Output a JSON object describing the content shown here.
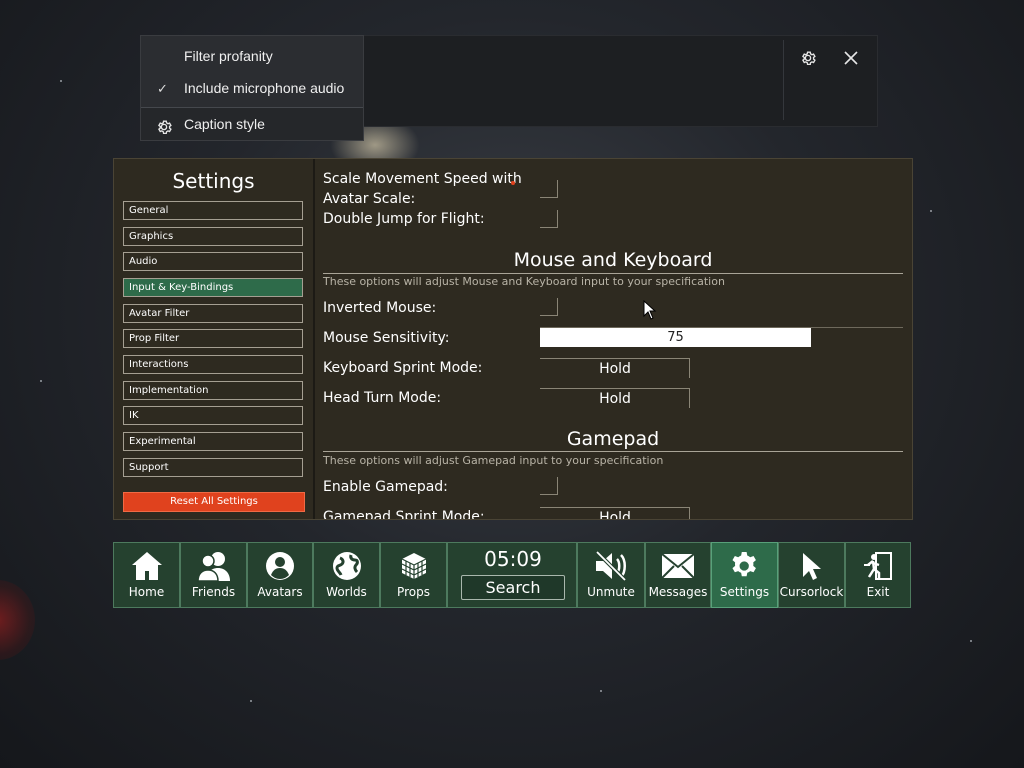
{
  "caption_menu": {
    "items": [
      {
        "label": "Filter profanity",
        "checked": false
      },
      {
        "label": "Include microphone audio",
        "checked": true
      }
    ],
    "caption_style_label": "Caption style"
  },
  "settings": {
    "title": "Settings",
    "sidebar": [
      {
        "label": "General"
      },
      {
        "label": "Graphics"
      },
      {
        "label": "Audio"
      },
      {
        "label": "Input & Key-Bindings",
        "active": true
      },
      {
        "label": "Avatar Filter"
      },
      {
        "label": "Prop Filter"
      },
      {
        "label": "Interactions"
      },
      {
        "label": "Implementation"
      },
      {
        "label": "IK"
      },
      {
        "label": "Experimental"
      },
      {
        "label": "Support"
      }
    ],
    "reset_label": "Reset All Settings",
    "content": {
      "scale_movement_label_line1": "Scale Movement Speed with",
      "scale_movement_label_line2": "Avatar Scale:",
      "double_jump_label": "Double Jump for Flight:",
      "mouse_keyboard": {
        "title": "Mouse and Keyboard",
        "description": "These options will adjust Mouse and Keyboard input to your specification",
        "inverted_mouse_label": "Inverted Mouse:",
        "mouse_sensitivity_label": "Mouse Sensitivity:",
        "mouse_sensitivity_value": "75",
        "keyboard_sprint_label": "Keyboard Sprint Mode:",
        "keyboard_sprint_value": "Hold",
        "head_turn_label": "Head Turn Mode:",
        "head_turn_value": "Hold"
      },
      "gamepad": {
        "title": "Gamepad",
        "description": "These options will adjust Gamepad input to your specification",
        "enable_gamepad_label": "Enable Gamepad:",
        "gamepad_sprint_label": "Gamepad Sprint Mode:",
        "gamepad_sprint_value": "Hold"
      }
    }
  },
  "taskbar": {
    "clock": "05:09",
    "search_label": "Search",
    "items": [
      {
        "label": "Home",
        "icon": "home-icon"
      },
      {
        "label": "Friends",
        "icon": "friends-icon"
      },
      {
        "label": "Avatars",
        "icon": "avatar-icon"
      },
      {
        "label": "Worlds",
        "icon": "globe-icon"
      },
      {
        "label": "Props",
        "icon": "cube-icon"
      },
      {
        "label": "Unmute",
        "icon": "muted-speaker-icon"
      },
      {
        "label": "Messages",
        "icon": "envelope-icon"
      },
      {
        "label": "Settings",
        "icon": "gear-icon",
        "active": true
      },
      {
        "label": "Cursorlock",
        "icon": "cursor-icon"
      },
      {
        "label": "Exit",
        "icon": "exit-icon"
      }
    ]
  },
  "colors": {
    "accent_green": "#2e6b4a",
    "reset_orange": "#e0421e",
    "panel_brown": "#2e2a20"
  }
}
